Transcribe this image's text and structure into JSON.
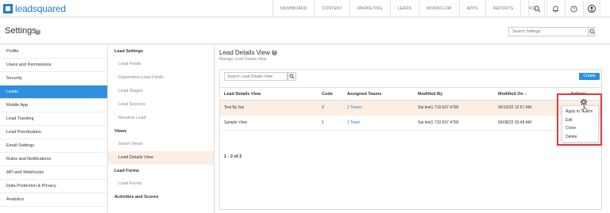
{
  "app": {
    "logo_text": "leadsquared"
  },
  "topnav": {
    "items": [
      "DASHBOARD",
      "CONTENT",
      "MARKETING",
      "LEADS",
      "WORKFLOW",
      "APPS",
      "REPORTS",
      "ACE"
    ],
    "icons": [
      "search-icon",
      "bell-icon",
      "help-icon",
      "user-icon"
    ]
  },
  "page": {
    "title": "Settings",
    "help_icon": "?",
    "search_placeholder": "Search Settings"
  },
  "sidebar": {
    "items": [
      {
        "label": "Profile"
      },
      {
        "label": "Users and Permissions"
      },
      {
        "label": "Security"
      },
      {
        "label": "Leads",
        "active": true
      },
      {
        "label": "Mobile App"
      },
      {
        "label": "Lead Tracking"
      },
      {
        "label": "Lead Prioritization"
      },
      {
        "label": "Email Settings"
      },
      {
        "label": "Rules and Notifications"
      },
      {
        "label": "API and Webhooks"
      },
      {
        "label": "Data Protection & Privacy"
      },
      {
        "label": "Analytics"
      }
    ]
  },
  "subnav": {
    "sections": [
      {
        "header": "Lead Settings",
        "items": [
          "Lead Fields",
          "Dependent Lead Fields",
          "Lead Stages",
          "Lead Sources",
          "Rename Lead"
        ]
      },
      {
        "header": "Views",
        "items": [
          "Smart Views",
          "Lead Details View"
        ]
      },
      {
        "header": "Lead Forms",
        "items": [
          "Lead Forms"
        ]
      },
      {
        "header": "Activities and Scores",
        "items": []
      }
    ],
    "active_item": "Lead Details View"
  },
  "main": {
    "title": "Lead Details View",
    "subtitle": "Manage Lead Details View",
    "search_placeholder": "Search Lead Details View",
    "create_label": "Create",
    "columns": [
      "Lead Details View",
      "Code",
      "Assigned Teams",
      "Modified By",
      "Modified On",
      "Actions"
    ],
    "sort_indicator": "↓",
    "rows": [
      {
        "name": "Test By Sai",
        "code": "2",
        "teams": "2 Teams",
        "modified_by": "Sai test1 719 637 4790",
        "modified_on": "06/10/22 12:57 AM"
      },
      {
        "name": "Sample View",
        "code": "1",
        "teams": "1 Team",
        "modified_by": "Sai test1 719 637 4790",
        "modified_on": "06/08/22 03:48 AM"
      }
    ],
    "pager": "1 - 2 of 2"
  },
  "actions_menu": {
    "items": [
      "Apply to Teams",
      "Edit",
      "Clone",
      "Delete"
    ]
  },
  "colors": {
    "accent": "#2d8fde",
    "highlight_row": "#fdeee4",
    "annotation": "#e03a3a",
    "brand": "#2a7ac7"
  }
}
